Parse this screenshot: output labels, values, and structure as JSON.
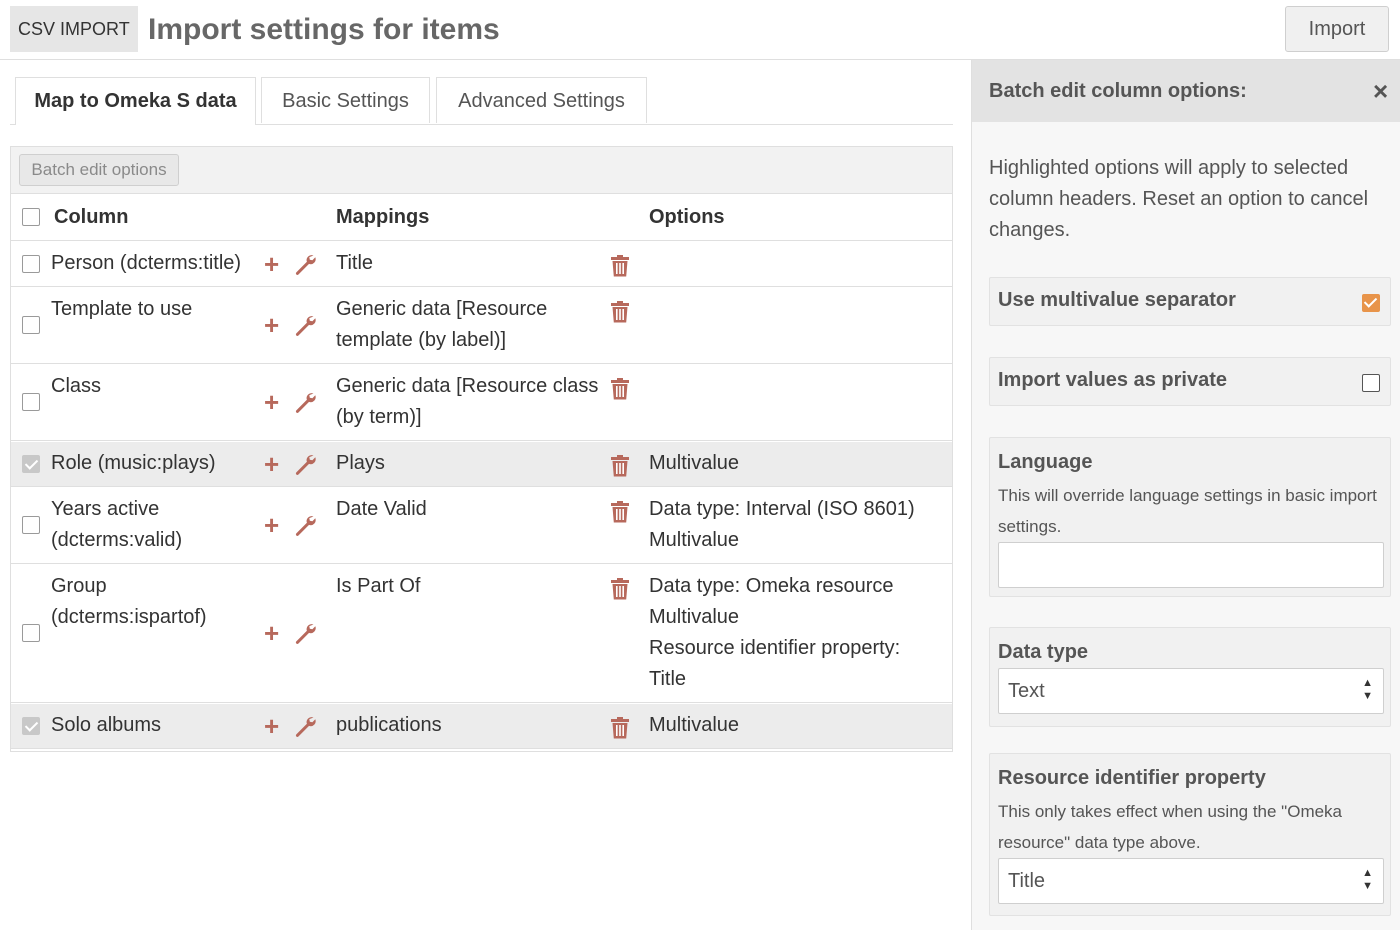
{
  "header": {
    "module_label": "CSV IMPORT",
    "title": "Import settings for items",
    "import_button": "Import"
  },
  "tabs": [
    {
      "label": "Map to Omeka S data",
      "active": true
    },
    {
      "label": "Basic Settings",
      "active": false
    },
    {
      "label": "Advanced Settings",
      "active": false
    }
  ],
  "table": {
    "batch_button": "Batch edit options",
    "headers": {
      "column": "Column",
      "mappings": "Mappings",
      "options": "Options"
    },
    "rows": [
      {
        "column": [
          "Person (dcterms:title)"
        ],
        "mapping": [
          "Title"
        ],
        "options": [],
        "selected": false
      },
      {
        "column": [
          "Template to use"
        ],
        "mapping": [
          "Generic data [Resource",
          "template (by label)]"
        ],
        "options": [],
        "selected": false
      },
      {
        "column": [
          "Class"
        ],
        "mapping": [
          "Generic data [Resource class",
          "(by term)]"
        ],
        "options": [],
        "selected": false
      },
      {
        "column": [
          "Role (music:plays)"
        ],
        "mapping": [
          "Plays"
        ],
        "options": [
          "Multivalue"
        ],
        "selected": true
      },
      {
        "column": [
          "Years active",
          "(dcterms:valid)"
        ],
        "mapping": [
          "Date Valid"
        ],
        "options": [
          "Data type: Interval (ISO 8601)",
          "Multivalue"
        ],
        "selected": false
      },
      {
        "column": [
          "Group",
          "(dcterms:ispartof)"
        ],
        "mapping": [
          "Is Part Of"
        ],
        "options": [
          "Data type: Omeka resource",
          "Multivalue",
          "Resource identifier property:",
          "Title"
        ],
        "selected": false
      },
      {
        "column": [
          "Solo albums"
        ],
        "mapping": [
          "publications"
        ],
        "options": [
          "Multivalue"
        ],
        "selected": true
      }
    ]
  },
  "icons": {
    "add": "plus-icon",
    "configure": "wrench-icon",
    "remove": "trash-icon",
    "close": "close-icon"
  },
  "colors": {
    "icon_accent": "#b7695c",
    "checkbox_on": "#e8944a",
    "selected_row": "#ececec"
  },
  "sidebar": {
    "title": "Batch edit column options:",
    "close_glyph": "×",
    "intro": "Highlighted options will apply to selected column headers. Reset an option to cancel changes.",
    "multivalue": {
      "label": "Use multivalue separator",
      "checked": true
    },
    "private": {
      "label": "Import values as private",
      "checked": false
    },
    "language": {
      "label": "Language",
      "help": "This will override language settings in basic import settings.",
      "value": ""
    },
    "data_type": {
      "label": "Data type",
      "value": "Text"
    },
    "resource_identifier": {
      "label": "Resource identifier property",
      "help": "This only takes effect when using the \"Omeka resource\" data type above.",
      "value": "Title"
    }
  }
}
